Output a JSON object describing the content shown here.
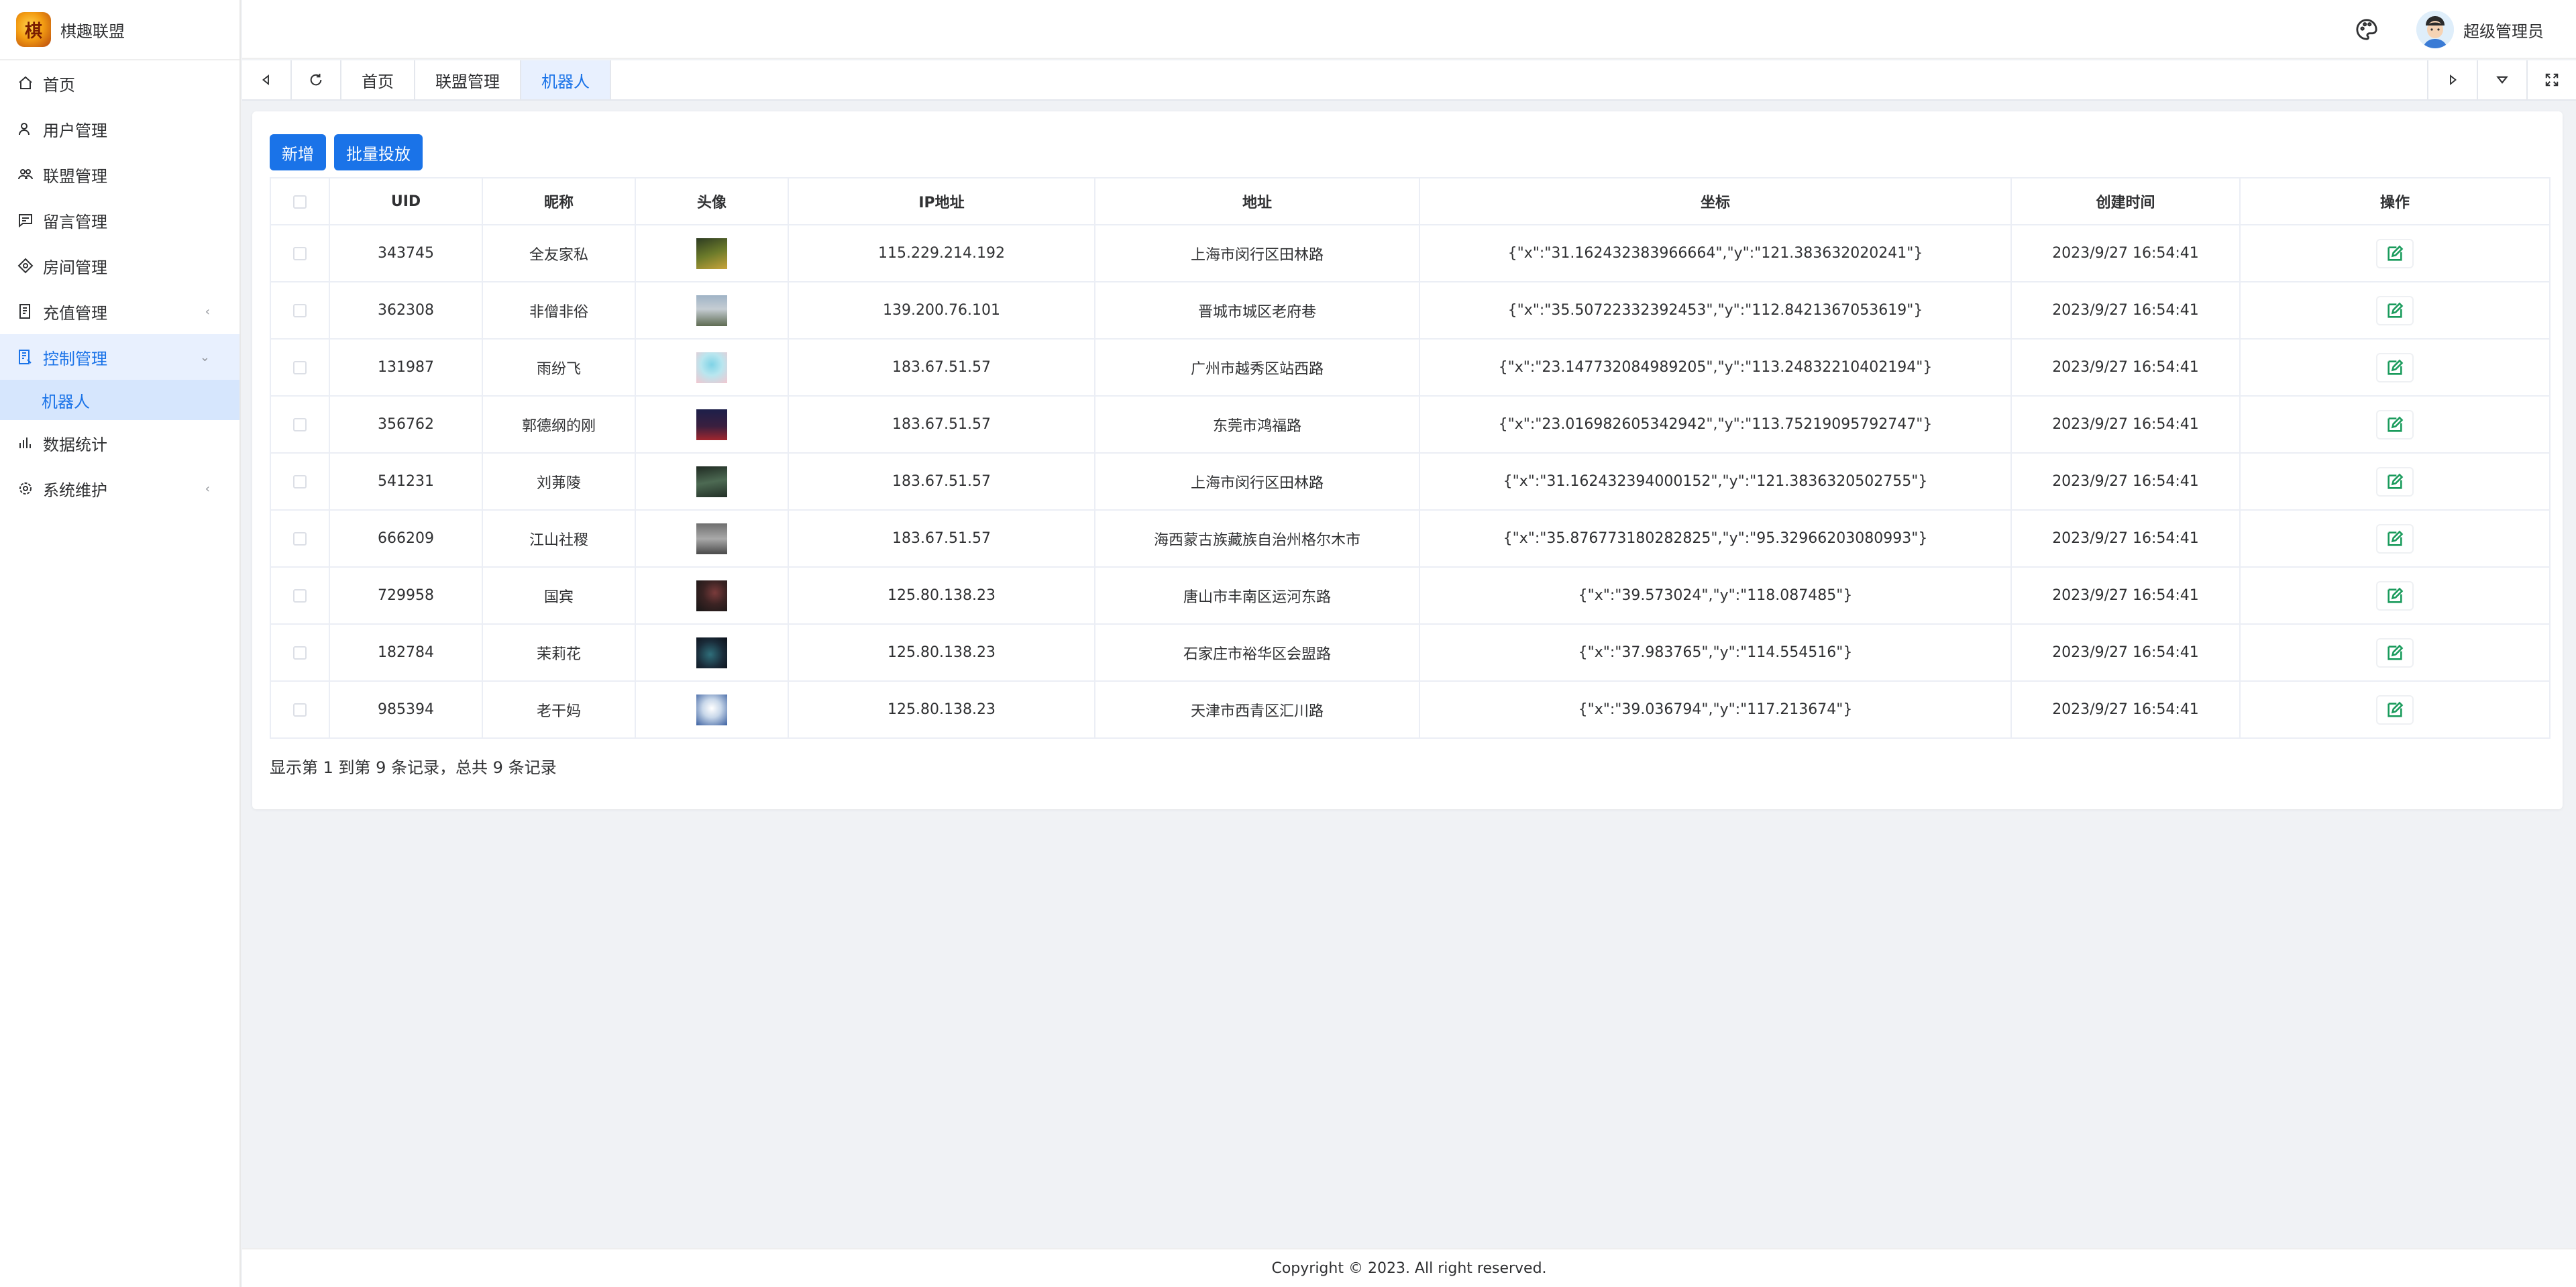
{
  "app": {
    "title": "棋趣联盟"
  },
  "sidebar": {
    "items": [
      {
        "label": "首页",
        "icon": "home-icon"
      },
      {
        "label": "用户管理",
        "icon": "user-icon"
      },
      {
        "label": "联盟管理",
        "icon": "group-icon"
      },
      {
        "label": "留言管理",
        "icon": "message-icon"
      },
      {
        "label": "房间管理",
        "icon": "room-icon"
      },
      {
        "label": "充值管理",
        "icon": "recharge-icon"
      },
      {
        "label": "控制管理",
        "icon": "control-icon"
      },
      {
        "label": "机器人"
      },
      {
        "label": "数据统计",
        "icon": "chart-icon"
      },
      {
        "label": "系统维护",
        "icon": "settings-icon"
      }
    ]
  },
  "header": {
    "username": "超级管理员"
  },
  "tabs": [
    {
      "label": "首页"
    },
    {
      "label": "联盟管理"
    },
    {
      "label": "机器人"
    }
  ],
  "toolbar": {
    "add_label": "新增",
    "batch_label": "批量投放"
  },
  "table": {
    "columns": [
      "UID",
      "昵称",
      "头像",
      "IP地址",
      "地址",
      "坐标",
      "创建时间",
      "操作"
    ],
    "rows": [
      {
        "uid": "343745",
        "nick": "全友家私",
        "ip": "115.229.214.192",
        "addr": "上海市闵行区田林路",
        "coord": "{\"x\":\"31.162432383966664\",\"y\":\"121.383632020241\"}",
        "time": "2023/9/27 16:54:41"
      },
      {
        "uid": "362308",
        "nick": "非僧非俗",
        "ip": "139.200.76.101",
        "addr": "晋城市城区老府巷",
        "coord": "{\"x\":\"35.50722332392453\",\"y\":\"112.8421367053619\"}",
        "time": "2023/9/27 16:54:41"
      },
      {
        "uid": "131987",
        "nick": "雨纷飞",
        "ip": "183.67.51.57",
        "addr": "广州市越秀区站西路",
        "coord": "{\"x\":\"23.147732084989205\",\"y\":\"113.24832210402194\"}",
        "time": "2023/9/27 16:54:41"
      },
      {
        "uid": "356762",
        "nick": "郭德纲的刚",
        "ip": "183.67.51.57",
        "addr": "东莞市鸿福路",
        "coord": "{\"x\":\"23.016982605342942\",\"y\":\"113.75219095792747\"}",
        "time": "2023/9/27 16:54:41"
      },
      {
        "uid": "541231",
        "nick": "刘茀陵",
        "ip": "183.67.51.57",
        "addr": "上海市闵行区田林路",
        "coord": "{\"x\":\"31.162432394000152\",\"y\":\"121.3836320502755\"}",
        "time": "2023/9/27 16:54:41"
      },
      {
        "uid": "666209",
        "nick": "江山社稷",
        "ip": "183.67.51.57",
        "addr": "海西蒙古族藏族自治州格尔木市",
        "coord": "{\"x\":\"35.876773180282825\",\"y\":\"95.32966203080993\"}",
        "time": "2023/9/27 16:54:41"
      },
      {
        "uid": "729958",
        "nick": "国宾",
        "ip": "125.80.138.23",
        "addr": "唐山市丰南区运河东路",
        "coord": "{\"x\":\"39.573024\",\"y\":\"118.087485\"}",
        "time": "2023/9/27 16:54:41"
      },
      {
        "uid": "182784",
        "nick": "茉莉花",
        "ip": "125.80.138.23",
        "addr": "石家庄市裕华区会盟路",
        "coord": "{\"x\":\"37.983765\",\"y\":\"114.554516\"}",
        "time": "2023/9/27 16:54:41"
      },
      {
        "uid": "985394",
        "nick": "老干妈",
        "ip": "125.80.138.23",
        "addr": "天津市西青区汇川路",
        "coord": "{\"x\":\"39.036794\",\"y\":\"117.213674\"}",
        "time": "2023/9/27 16:54:41"
      }
    ]
  },
  "pagination": {
    "summary": "显示第 1 到第 9 条记录，总共 9 条记录"
  },
  "footer": {
    "copyright": "Copyright © 2023. All right reserved."
  },
  "colors": {
    "accent": "#1a73e8",
    "edit_icon": "#1a9b5c"
  }
}
